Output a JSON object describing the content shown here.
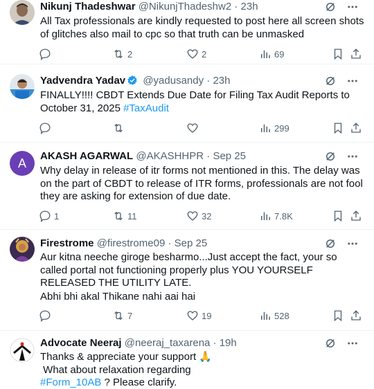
{
  "tweets": [
    {
      "name": "Nikunj Thadeshwar",
      "handle": "@NikunjThadeshw2",
      "time": "23h",
      "text": "All Tax professionals are kindly requested to post here all screen shots of glitches also mail to cpc so that truth can be unmasked",
      "replies": "",
      "retweets": "2",
      "likes": "2",
      "views": "69"
    },
    {
      "name": "Yadvendra Yadav",
      "handle": "@yadusandy",
      "time": "23h",
      "text_before": "FINALLY!!!! CBDT Extends Due Date for Filing Tax Audit Reports to October 31, 2025 ",
      "hashtag": "#TaxAudit",
      "replies": "",
      "retweets": "",
      "likes": "",
      "views": "299"
    },
    {
      "name": "AKASH AGARWAL",
      "handle": "@AKASHHPR",
      "time": "Sep 25",
      "avatar_letter": "A",
      "text": "Why delay in release of itr forms not mentioned in this. The delay was on the part of CBDT to release of ITR forms, professionals are not fool they are asking for extension of due date.",
      "replies": "1",
      "retweets": "11",
      "likes": "32",
      "views": "7.8K"
    },
    {
      "name": "Firestrome",
      "handle": "@firestrome09",
      "time": "Sep 25",
      "text": "Aur kitna neeche giroge besharmo...Just accept the fact, your so called portal not functioning properly plus YOU YOURSELF RELEASED THE UTILITY LATE.",
      "text2": "Abhi bhi akal Thikane nahi aai hai",
      "replies": "",
      "retweets": "7",
      "likes": "19",
      "views": "528"
    },
    {
      "name": "Advocate Neeraj",
      "handle": "@neeraj_taxarena",
      "time": "19h",
      "line1": "Thanks & appreciate your support 🙏",
      "line2": " What about relaxation regarding",
      "hashtag": "#Form_10AB",
      "line3_rest": " ? Please clarify."
    }
  ],
  "separator": "·",
  "colors": {
    "text": "#0f1419",
    "secondary": "#536471",
    "link": "#1d9bf0",
    "divider": "#eff3f4",
    "avatar_purple": "#6a3fb5"
  },
  "icons": [
    "grok-icon",
    "more-icon",
    "reply-icon",
    "retweet-icon",
    "like-icon",
    "views-icon",
    "bookmark-icon",
    "share-icon",
    "verified-badge-icon"
  ]
}
